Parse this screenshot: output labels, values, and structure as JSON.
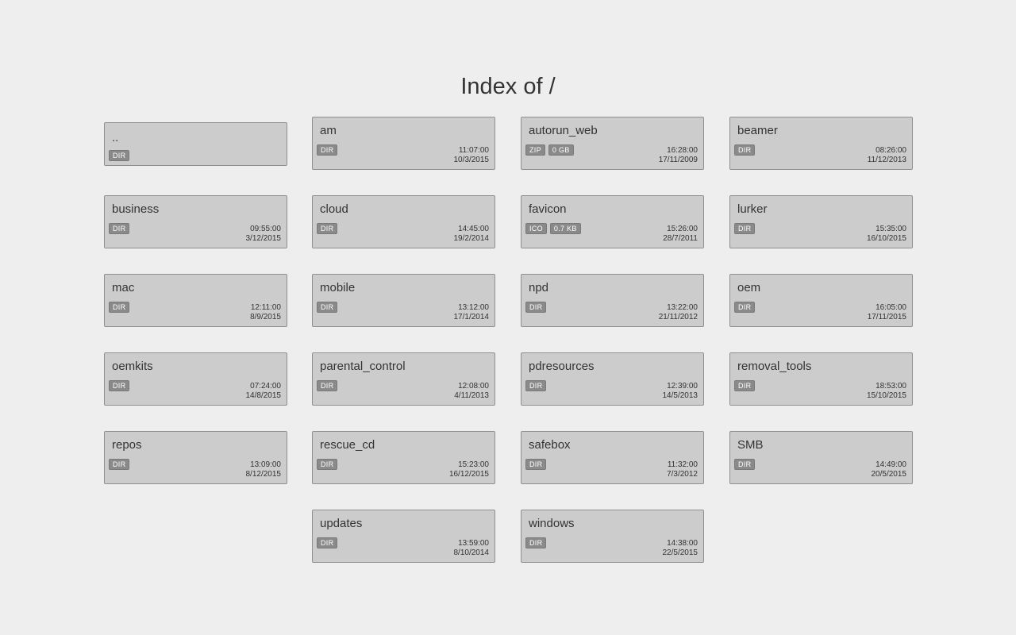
{
  "title": "Index of /",
  "entries": [
    {
      "name": "..",
      "badges": [
        "DIR"
      ],
      "time": "",
      "date": ""
    },
    {
      "name": "am",
      "badges": [
        "DIR"
      ],
      "time": "11:07:00",
      "date": "10/3/2015"
    },
    {
      "name": "autorun_web",
      "badges": [
        "ZIP",
        "0 GB"
      ],
      "time": "16:28:00",
      "date": "17/11/2009"
    },
    {
      "name": "beamer",
      "badges": [
        "DIR"
      ],
      "time": "08:26:00",
      "date": "11/12/2013"
    },
    {
      "name": "business",
      "badges": [
        "DIR"
      ],
      "time": "09:55:00",
      "date": "3/12/2015"
    },
    {
      "name": "cloud",
      "badges": [
        "DIR"
      ],
      "time": "14:45:00",
      "date": "19/2/2014"
    },
    {
      "name": "favicon",
      "badges": [
        "ICO",
        "0.7 KB"
      ],
      "time": "15:26:00",
      "date": "28/7/2011"
    },
    {
      "name": "lurker",
      "badges": [
        "DIR"
      ],
      "time": "15:35:00",
      "date": "16/10/2015"
    },
    {
      "name": "mac",
      "badges": [
        "DIR"
      ],
      "time": "12:11:00",
      "date": "8/9/2015"
    },
    {
      "name": "mobile",
      "badges": [
        "DIR"
      ],
      "time": "13:12:00",
      "date": "17/1/2014"
    },
    {
      "name": "npd",
      "badges": [
        "DIR"
      ],
      "time": "13:22:00",
      "date": "21/11/2012"
    },
    {
      "name": "oem",
      "badges": [
        "DIR"
      ],
      "time": "16:05:00",
      "date": "17/11/2015"
    },
    {
      "name": "oemkits",
      "badges": [
        "DIR"
      ],
      "time": "07:24:00",
      "date": "14/8/2015"
    },
    {
      "name": "parental_control",
      "badges": [
        "DIR"
      ],
      "time": "12:08:00",
      "date": "4/11/2013"
    },
    {
      "name": "pdresources",
      "badges": [
        "DIR"
      ],
      "time": "12:39:00",
      "date": "14/5/2013"
    },
    {
      "name": "removal_tools",
      "badges": [
        "DIR"
      ],
      "time": "18:53:00",
      "date": "15/10/2015"
    },
    {
      "name": "repos",
      "badges": [
        "DIR"
      ],
      "time": "13:09:00",
      "date": "8/12/2015"
    },
    {
      "name": "rescue_cd",
      "badges": [
        "DIR"
      ],
      "time": "15:23:00",
      "date": "16/12/2015"
    },
    {
      "name": "safebox",
      "badges": [
        "DIR"
      ],
      "time": "11:32:00",
      "date": "7/3/2012"
    },
    {
      "name": "SMB",
      "badges": [
        "DIR"
      ],
      "time": "14:49:00",
      "date": "20/5/2015"
    },
    {
      "name": "updates",
      "badges": [
        "DIR"
      ],
      "time": "13:59:00",
      "date": "8/10/2014"
    },
    {
      "name": "windows",
      "badges": [
        "DIR"
      ],
      "time": "14:38:00",
      "date": "22/5/2015"
    }
  ]
}
